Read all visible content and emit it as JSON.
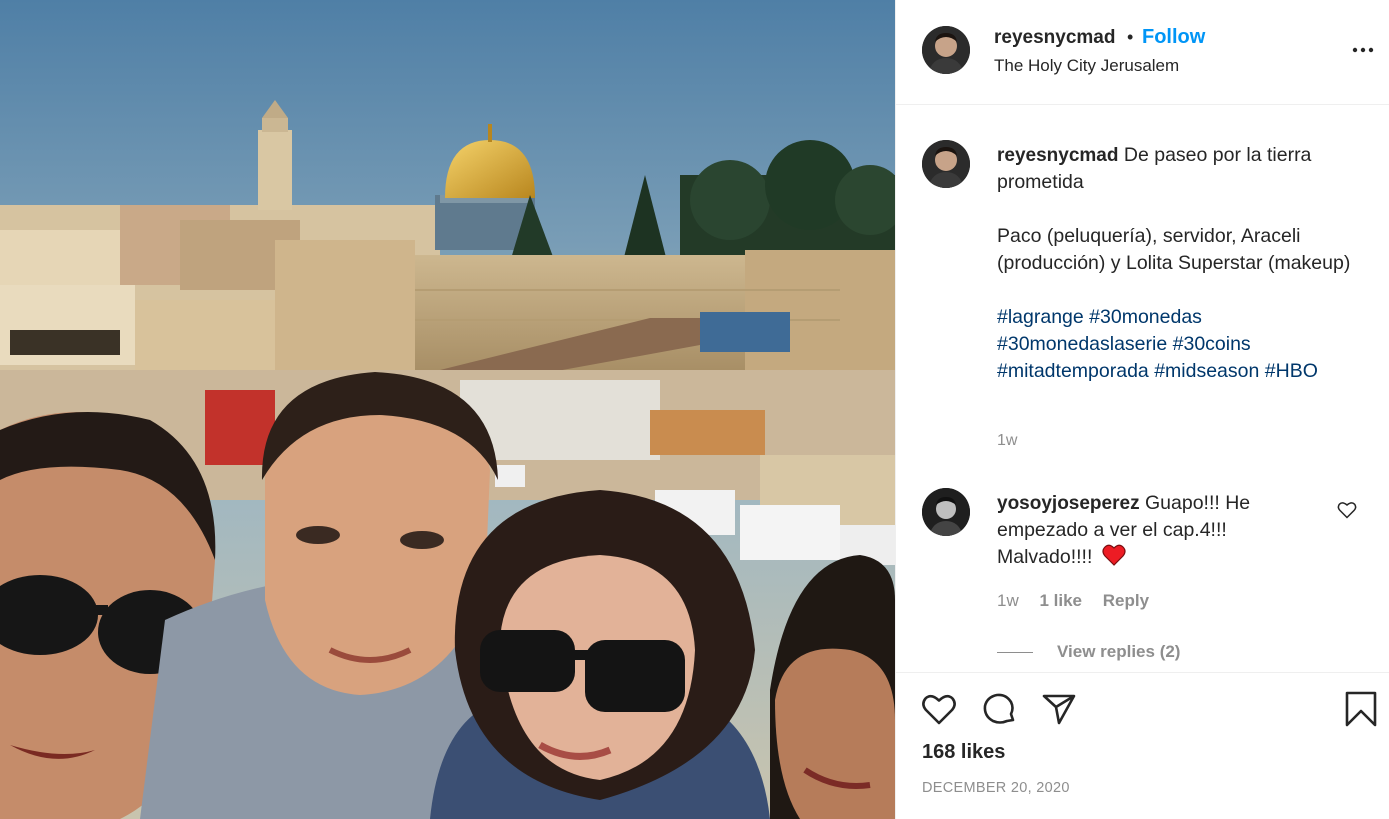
{
  "post": {
    "username": "reyesnycmad",
    "follow_label": "Follow",
    "dot": "•",
    "location": "The Holy City Jerusalem",
    "image_alt": "Selfie of four people in front of the Western Wall and the Dome of the Rock in Jerusalem"
  },
  "caption": {
    "username": "reyesnycmad",
    "line1": "De paseo por la tierra prometida",
    "line2": "Paco (peluquería), servidor, Araceli (producción) y Lolita Superstar (makeup)",
    "hashtags": [
      "#lagrange",
      "#30monedas",
      "#30monedaslaserie",
      "#30coins",
      "#mitadtemporada",
      "#midseason",
      "#HBO"
    ],
    "time": "1w"
  },
  "comments": [
    {
      "username": "yosoyjoseperez",
      "text": "Guapo!!! He empezado a ver el cap.4!!! Malvado!!!!",
      "time": "1w",
      "likes": "1 like",
      "reply_label": "Reply",
      "view_replies": "View replies (2)"
    }
  ],
  "actions": {
    "likes": "168 likes",
    "date": "DECEMBER 20, 2020"
  },
  "colors": {
    "link_blue": "#0095f6",
    "hashtag": "#00376b",
    "muted": "#8e8e8e",
    "text": "#262626",
    "heart_red": "#ed1c24"
  },
  "icons": [
    "more-options-icon",
    "heart-outline-icon",
    "comment-icon",
    "share-icon",
    "bookmark-icon",
    "red-heart-emoji"
  ]
}
